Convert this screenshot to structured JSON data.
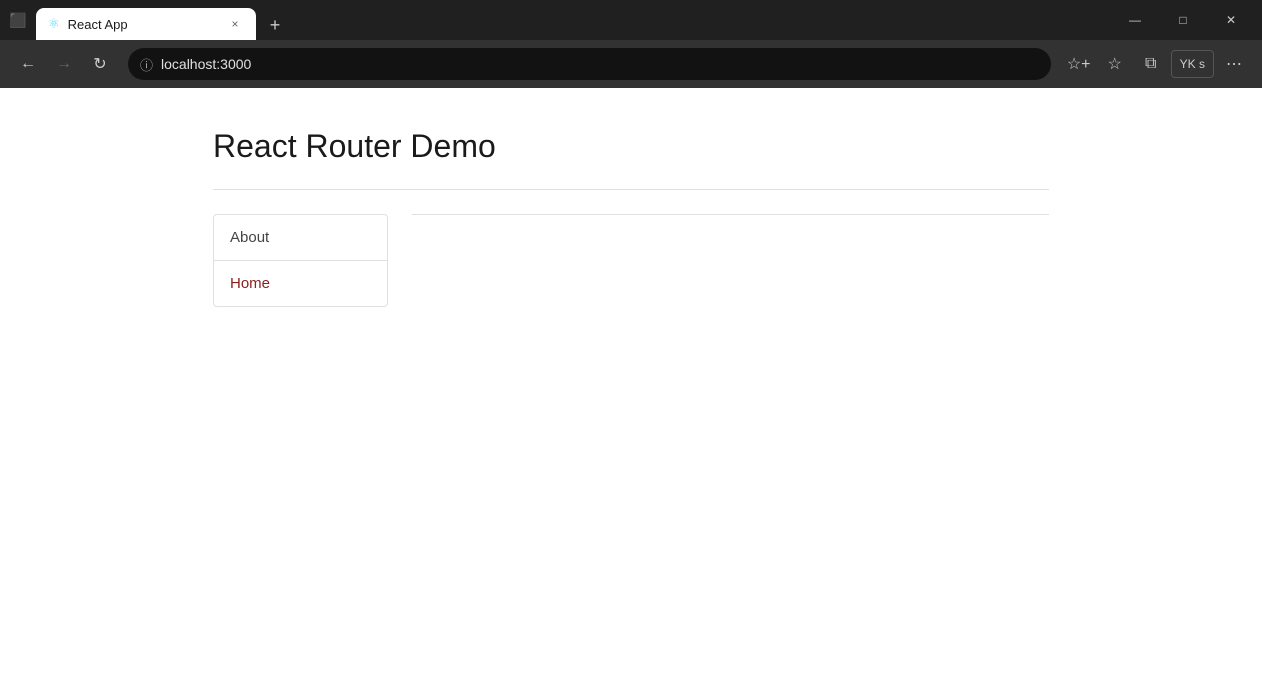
{
  "browser": {
    "tab": {
      "favicon": "⚛",
      "title": "React App",
      "close_label": "×",
      "new_tab_label": "+"
    },
    "window_controls": {
      "minimize": "—",
      "maximize": "□",
      "close": "✕"
    },
    "nav": {
      "back_arrow": "←",
      "forward_arrow": "→",
      "refresh": "↻",
      "address_info": "ⓘ",
      "url_host": "localhost",
      "url_port": ":3000",
      "add_favorite_label": "☆+",
      "favorites_label": "☆",
      "collections_label": "⧉",
      "profile_label": "YK s",
      "more_label": "⋯"
    }
  },
  "page": {
    "title": "React Router Demo",
    "nav_items": [
      {
        "label": "About",
        "style": "about"
      },
      {
        "label": "Home",
        "style": "home"
      }
    ]
  }
}
